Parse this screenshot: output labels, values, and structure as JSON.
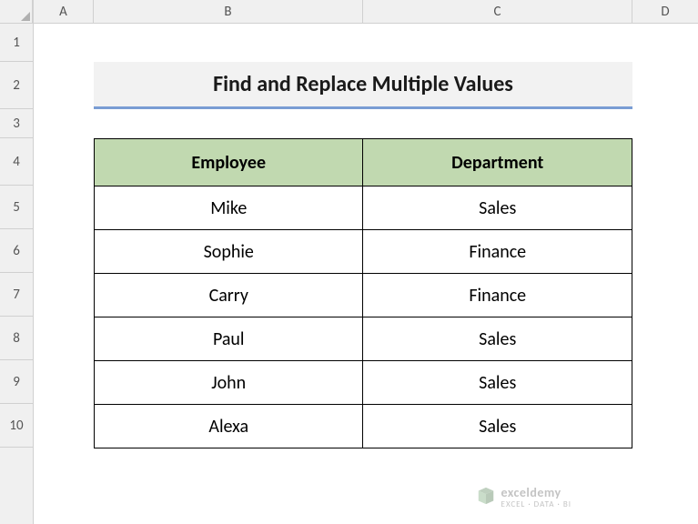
{
  "columns": {
    "A": "A",
    "B": "B",
    "C": "C",
    "D": "D"
  },
  "rows": {
    "r1": "1",
    "r2": "2",
    "r3": "3",
    "r4": "4",
    "r5": "5",
    "r6": "6",
    "r7": "7",
    "r8": "8",
    "r9": "9",
    "r10": "10"
  },
  "title": "Find and Replace Multiple Values",
  "headers": {
    "employee": "Employee",
    "department": "Department"
  },
  "data": [
    {
      "employee": "Mike",
      "department": "Sales"
    },
    {
      "employee": "Sophie",
      "department": "Finance"
    },
    {
      "employee": "Carry",
      "department": "Finance"
    },
    {
      "employee": "Paul",
      "department": "Sales"
    },
    {
      "employee": "John",
      "department": "Sales"
    },
    {
      "employee": "Alexa",
      "department": "Sales"
    }
  ],
  "watermark": {
    "main": "exceldemy",
    "sub": "EXCEL · DATA · BI"
  }
}
